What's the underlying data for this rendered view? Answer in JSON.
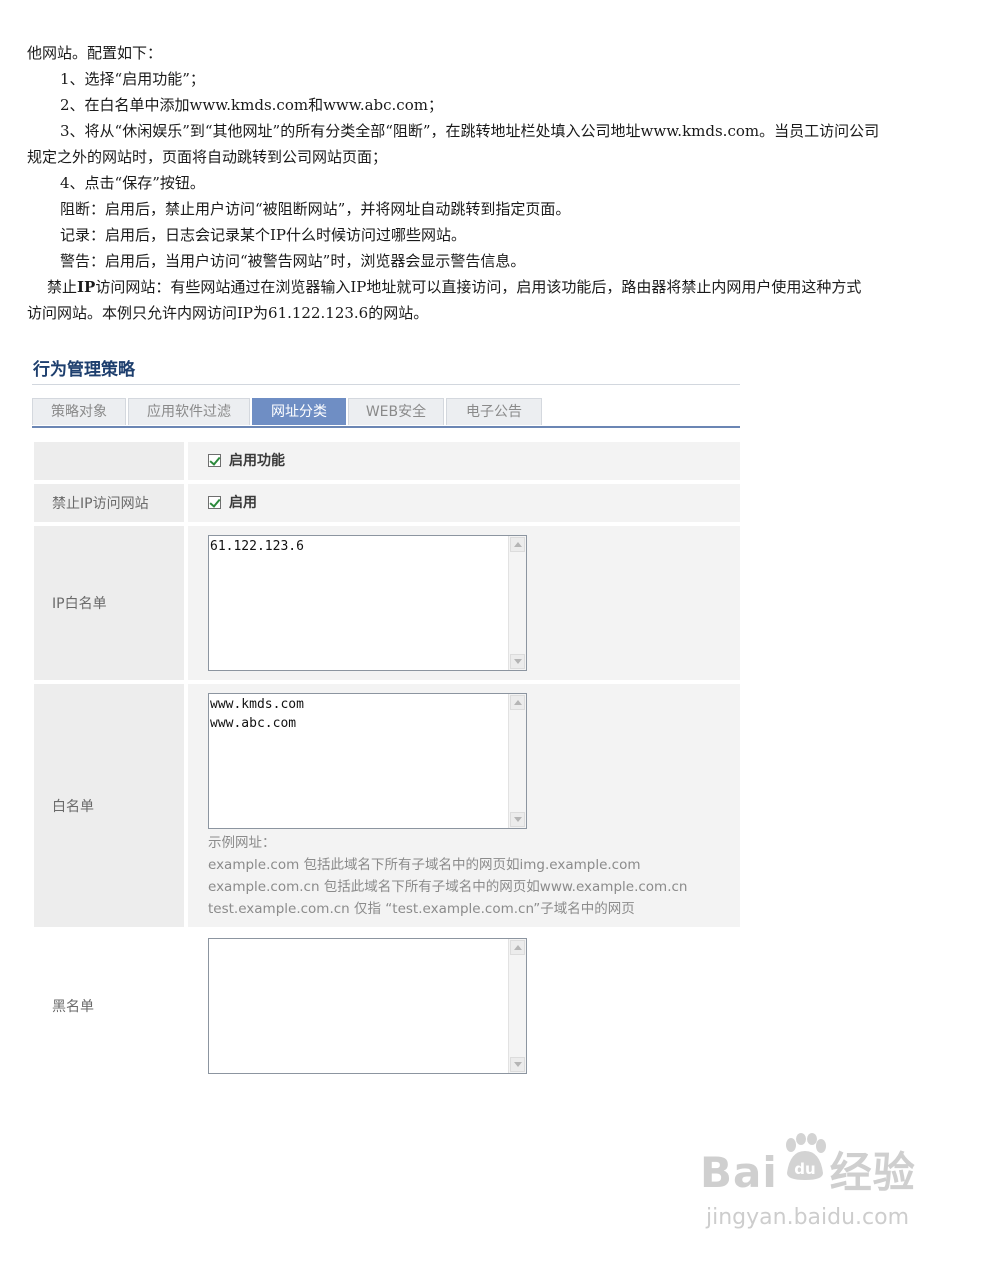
{
  "document": {
    "lines": [
      "他网站。配置如下：",
      "1、选择“启用功能”；",
      "2、在白名单中添加www.kmds.com和www.abc.com；",
      "3、将从“休闲娱乐”到“其他网址”的所有分类全部“阻断”，在跳转地址栏处填入公司地址www.kmds.com。当员工访问公司",
      "规定之外的网站时，页面将自动跳转到公司网站页面；",
      "4、点击“保存”按钮。",
      "阻断：启用后，禁止用户访问“被阻断网站”，并将网址自动跳转到指定页面。",
      "记录：启用后，日志会记录某个IP什么时候访问过哪些网站。",
      "警告：启用后，当用户访问“被警告网站”时，浏览器会显示警告信息。"
    ],
    "para_prefix": "禁止",
    "para_bold": "IP",
    "para_rest": "访问网站：有些网站通过在浏览器输入IP地址就可以直接访问，启用该功能后，路由器将禁止内网用户使用这种方式",
    "para_last": "访问网站。本例只允许内网访问IP为61.122.123.6的网站。"
  },
  "panel": {
    "title": "行为管理策略",
    "tabs": [
      "策略对象",
      "应用软件过滤",
      "网址分类",
      "WEB安全",
      "电子公告"
    ],
    "active_tab": "网址分类",
    "enable_feature_label": "启用功能",
    "ban_ip_label": "禁止IP访问网站",
    "ban_ip_check_label": "启用",
    "ip_whitelist_label": "IP白名单",
    "ip_whitelist_value": "61.122.123.6",
    "whitelist_label": "白名单",
    "whitelist_value": "www.kmds.com\nwww.abc.com",
    "hint_title": "示例网址：",
    "hint_lines": [
      "example.com 包括此域名下所有子域名中的网页如img.example.com",
      "example.com.cn 包括此域名下所有子域名中的网页如www.example.com.cn",
      "test.example.com.cn 仅指 “test.example.com.cn”子域名中的网页"
    ],
    "blacklist_label": "黑名单",
    "blacklist_value": ""
  },
  "watermark": {
    "brand_prefix": "Bai",
    "brand_suffix": "经验",
    "paw_text": "du",
    "url": "jingyan.baidu.com"
  }
}
